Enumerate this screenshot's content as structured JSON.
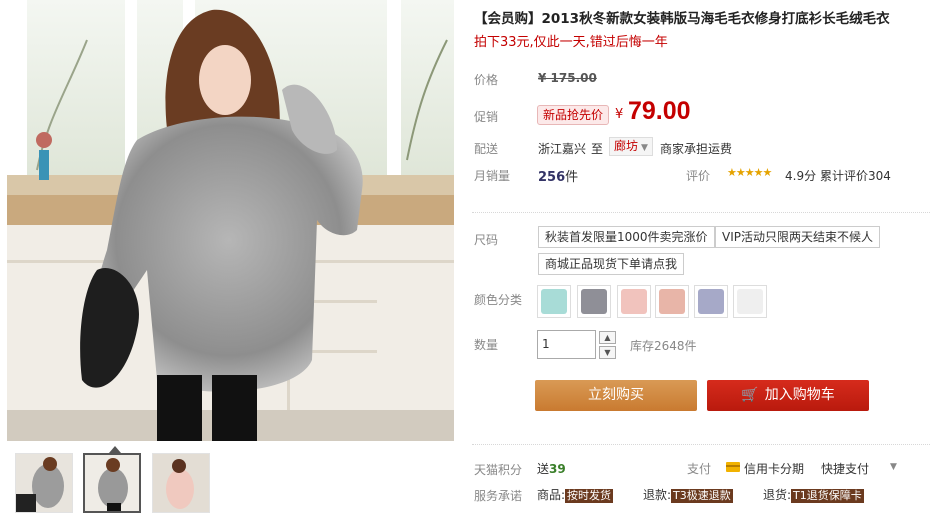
{
  "product": {
    "title": "【会员购】2013秋冬新款女装韩版马海毛毛衣修身打底衫长毛绒毛衣",
    "subtitle": "拍下33元,仅此一天,错过后悔一年"
  },
  "price": {
    "label": "价格",
    "original": "¥ 175.00",
    "promo_label": "促销",
    "promo_badge": "新品抢先价",
    "currency": "¥",
    "current": "79.00"
  },
  "shipping": {
    "label": "配送",
    "origin": "浙江嘉兴",
    "to": "至",
    "destination": "廊坊",
    "fee": "商家承担运费"
  },
  "sales": {
    "label": "月销量",
    "count": "256",
    "unit": "件",
    "rating_label": "评价",
    "stars": "★★★★★",
    "score": "4.9分",
    "total_reviews": "累计评价304"
  },
  "size": {
    "label": "尺码",
    "options": [
      "秋装首发限量1000件卖完涨价",
      "VIP活动只限两天结束不候人",
      "商城正品现货下单请点我"
    ]
  },
  "color": {
    "label": "颜色分类",
    "swatches": [
      "#a8dcd7",
      "#8f8f97",
      "#f1c3bd",
      "#e8b5a8",
      "#a6a9c8",
      "#efefef"
    ]
  },
  "quantity": {
    "label": "数量",
    "value": "1",
    "stock": "库存2648件"
  },
  "actions": {
    "buy_now": "立刻购买",
    "add_to_cart": "加入购物车"
  },
  "points": {
    "label": "天猫积分",
    "prefix": "送",
    "value": "39",
    "pay_label": "支付",
    "credit_card": "信用卡分期",
    "quick_pay": "快捷支付"
  },
  "service": {
    "label": "服务承诺",
    "goods_label": "商品:",
    "goods_tag": "按时发货",
    "refund_label": "退款:",
    "refund_tag": "T3极速退款",
    "return_label": "退货:",
    "return_tag": "T1退货保障卡"
  }
}
